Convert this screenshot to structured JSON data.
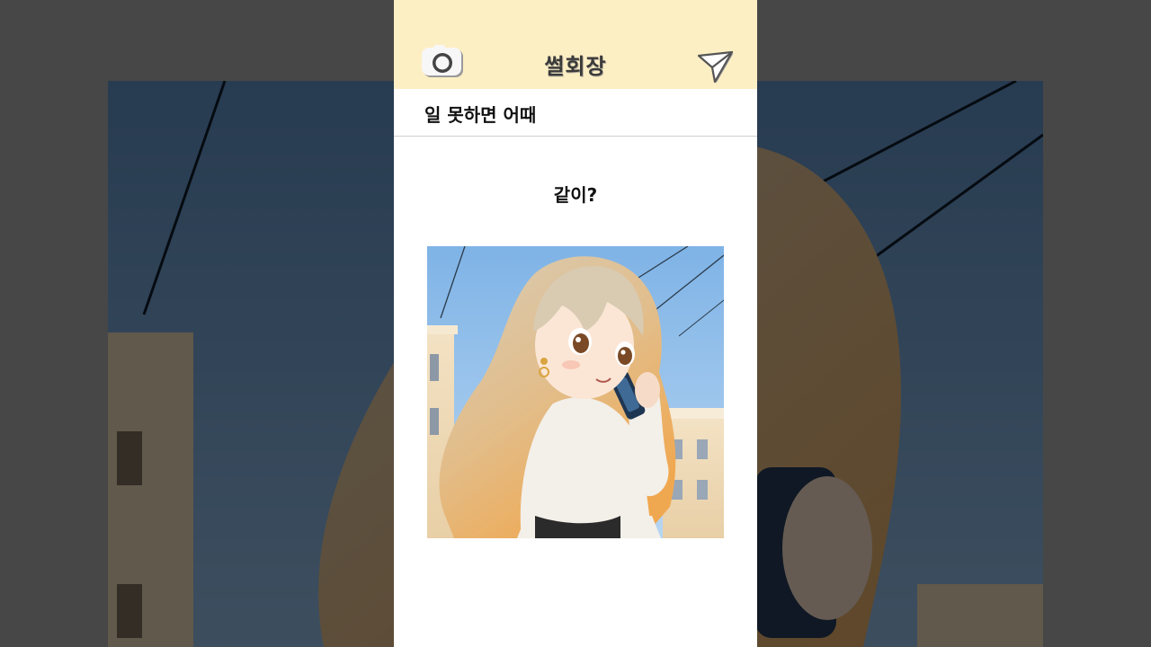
{
  "header": {
    "title": "썰회장",
    "left_icon": "camera-icon",
    "right_icon": "paper-plane-send-icon",
    "background_color": "#fdefc4"
  },
  "post": {
    "title": "일 못하면 어때",
    "caption": "같이?",
    "image_subject": "anime girl with long wavy blonde hair talking on a phone outdoors"
  }
}
